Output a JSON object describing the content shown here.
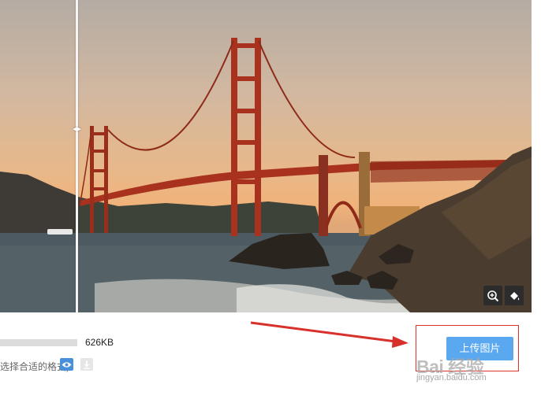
{
  "photo": {
    "alt_subject": "Golden Gate Bridge at sunset",
    "compare_handle_glyph": "◂▸"
  },
  "tools": {
    "zoom_icon": "zoom-in-icon",
    "fill_icon": "paint-bucket-icon"
  },
  "file": {
    "size": "626KB",
    "format_hint": "(选择合适的格式)",
    "progress": 1.0
  },
  "actions": {
    "preview_icon": "eye-icon",
    "download_icon": "download-icon",
    "upload_label": "上传图片"
  },
  "watermark": {
    "text": "Bai 经验",
    "url": "jingyan.baidu.com"
  },
  "colors": {
    "accent": "#5aa8f0",
    "annotation": "#e0322c",
    "bridge": "#a8321e"
  }
}
